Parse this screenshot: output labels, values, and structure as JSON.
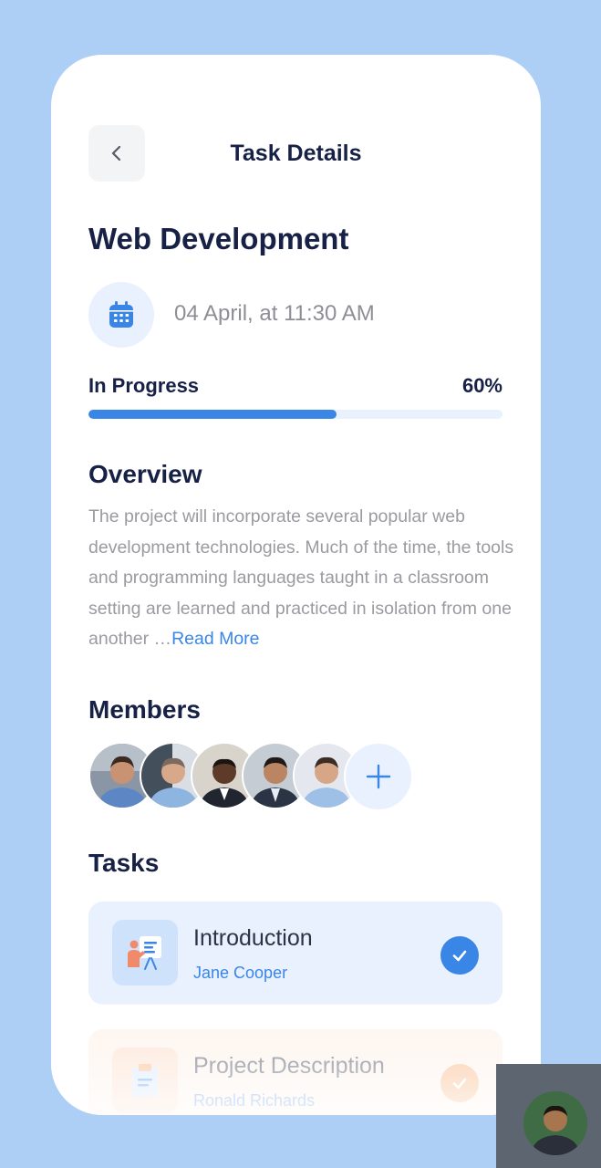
{
  "header": {
    "title": "Task Details"
  },
  "project": {
    "title": "Web Development",
    "date": "04 April, at 11:30 AM",
    "status": "In Progress",
    "progress_label": "60%",
    "progress_fraction": 0.6
  },
  "overview": {
    "title": "Overview",
    "text": "The project will incorporate several popular web development technologies. Much of the time, the tools and programming languages taught in a classroom setting are learned and practiced in isolation from one another …",
    "read_more": "Read More"
  },
  "members": {
    "title": "Members",
    "avatars": [
      "member-avatar",
      "member-avatar",
      "member-avatar",
      "member-avatar",
      "member-avatar"
    ],
    "add_icon": "plus-icon"
  },
  "tasks": {
    "title": "Tasks",
    "items": [
      {
        "name": "Introduction",
        "person": "Jane Cooper",
        "icon": "presentation-icon",
        "done": true
      },
      {
        "name": "Project Description",
        "person": "Ronald Richards",
        "icon": "clipboard-icon",
        "done": true
      }
    ]
  },
  "colors": {
    "accent": "#3a86e6",
    "heading": "#172045",
    "background": "#aecff5",
    "task_blue_bg": "#e8f1fd",
    "task_orange_bg": "#fdeee4",
    "check_orange": "#f6a86b"
  }
}
